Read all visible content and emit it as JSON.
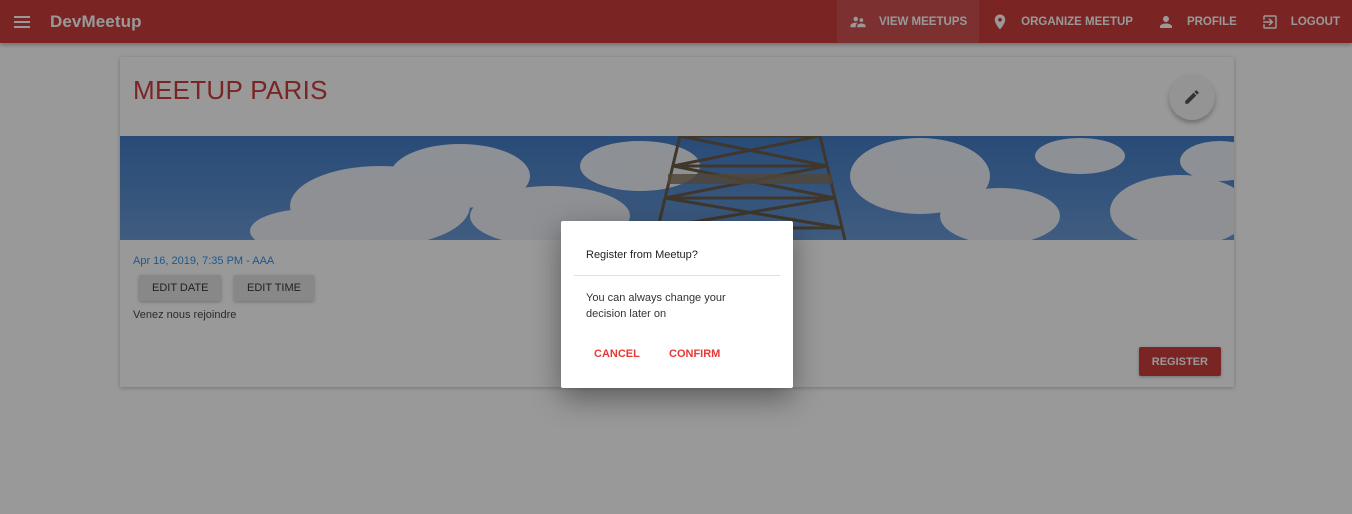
{
  "app": {
    "title": "DevMeetup"
  },
  "nav": {
    "items": [
      {
        "label": "VIEW MEETUPS",
        "icon": "supervisor-account-icon"
      },
      {
        "label": "ORGANIZE MEETUP",
        "icon": "room-icon"
      },
      {
        "label": "PROFILE",
        "icon": "person-icon"
      },
      {
        "label": "LOGOUT",
        "icon": "exit-to-app-icon"
      }
    ],
    "active_index": 0
  },
  "meetup": {
    "title": "MEETUP PARIS",
    "date_location": "Apr 16, 2019, 7:35 PM - AAA",
    "edit_date_label": "EDIT DATE",
    "edit_time_label": "EDIT TIME",
    "description": "Venez nous rejoindre",
    "register_label": "REGISTER",
    "image": "eiffel-tower-sky"
  },
  "dialog": {
    "title": "Register from Meetup?",
    "text": "You can always change your decision later on",
    "cancel_label": "CANCEL",
    "confirm_label": "CONFIRM"
  },
  "colors": {
    "primary": "#c62828",
    "accent": "#e53935",
    "link": "#1e88e5"
  }
}
